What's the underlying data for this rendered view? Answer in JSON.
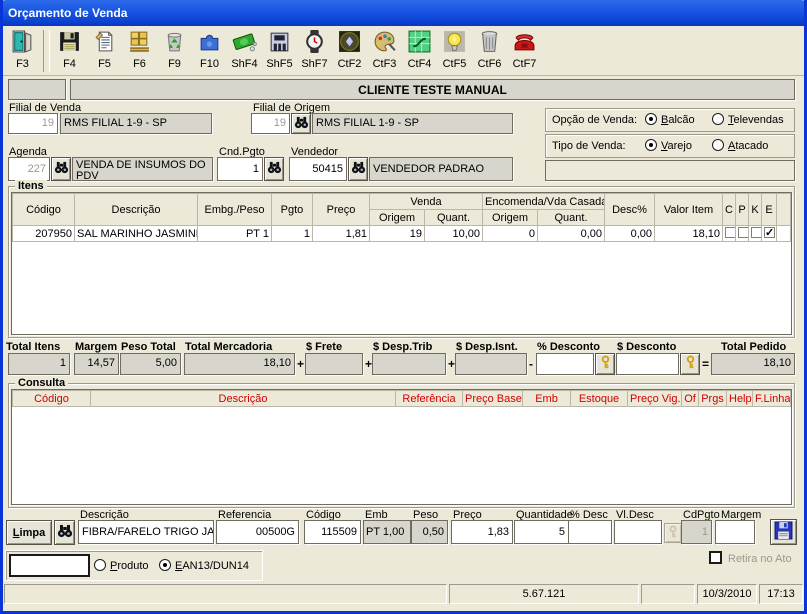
{
  "window": {
    "title": "Orçamento de Venda"
  },
  "colors": {
    "titlebar_blue": "#1755E2",
    "window_border": "#0834D8",
    "consulta_header_red": "#D40000",
    "background": "#ECE9D8"
  },
  "toolbar": {
    "buttons": [
      {
        "label": "F3",
        "icon": "exit-door-icon"
      },
      {
        "label": "F4",
        "icon": "save-floppy-icon"
      },
      {
        "label": "F5",
        "icon": "document-edit-icon"
      },
      {
        "label": "F6",
        "icon": "pallet-boxes-icon"
      },
      {
        "label": "F9",
        "icon": "recycle-bin-icon"
      },
      {
        "label": "F10",
        "icon": "puzzle-piece-icon"
      },
      {
        "label": "ShF4",
        "icon": "money-bill-icon"
      },
      {
        "label": "ShF5",
        "icon": "building-icon"
      },
      {
        "label": "ShF7",
        "icon": "watch-icon"
      },
      {
        "label": "CtF2",
        "icon": "emblem-icon"
      },
      {
        "label": "CtF3",
        "icon": "palette-icon"
      },
      {
        "label": "CtF4",
        "icon": "green-grid-icon"
      },
      {
        "label": "CtF5",
        "icon": "light-bulb-icon"
      },
      {
        "label": "CtF6",
        "icon": "trash-can-icon"
      },
      {
        "label": "CtF7",
        "icon": "red-phone-icon"
      }
    ]
  },
  "client": {
    "name": "CLIENTE TESTE MANUAL"
  },
  "filial_venda": {
    "label": "Filial de Venda",
    "code": "19",
    "name": "RMS FILIAL 1-9 - SP"
  },
  "filial_origem": {
    "label": "Filial de Origem",
    "code": "19",
    "name": "RMS FILIAL 1-9 - SP"
  },
  "opcao_venda": {
    "label": "Opção de Venda:",
    "balcao": "Balcão",
    "balcao_selected": true,
    "televendas": "Televendas",
    "televendas_selected": false
  },
  "tipo_venda": {
    "label": "Tipo de Venda:",
    "varejo": "Varejo",
    "varejo_selected": true,
    "atacado": "Atacado",
    "atacado_selected": false
  },
  "agenda": {
    "label": "Agenda",
    "code": "227",
    "name": "VENDA DE INSUMOS DO PDV"
  },
  "cnd_pgto": {
    "label": "Cnd.Pgto",
    "value": "1"
  },
  "vendedor": {
    "label": "Vendedor",
    "code": "50415",
    "name": "VENDEDOR PADRAO"
  },
  "itens": {
    "group_label": "Itens",
    "header": {
      "codigo": "Código",
      "descricao": "Descrição",
      "emb_peso": "Embg./Peso",
      "pgto": "Pgto",
      "preco": "Preço",
      "venda": "Venda",
      "venda_origem": "Origem",
      "venda_quant": "Quant.",
      "encomenda": "Encomenda/Vda Casada",
      "enc_origem": "Origem",
      "enc_quant": "Quant.",
      "desc_pct": "Desc%",
      "valor_item": "Valor Item",
      "c": "C",
      "p": "P",
      "k": "K",
      "e": "E"
    },
    "rows": [
      {
        "codigo": "207950",
        "descricao": "SAL MARINHO JASMINE",
        "emb_peso": "PT 1",
        "pgto": "1",
        "preco": "1,81",
        "venda_origem": "19",
        "venda_quant": "10,00",
        "enc_origem": "0",
        "enc_quant": "0,00",
        "desc_pct": "0,00",
        "valor_item": "18,10",
        "c": false,
        "p": false,
        "k": false,
        "e": true
      }
    ]
  },
  "totais": {
    "total_itens_label": "Total Itens",
    "total_itens": "1",
    "margem_label": "Margem",
    "margem": "14,57",
    "peso_total_label": "Peso Total",
    "peso_total": "5,00",
    "total_mercadoria_label": "Total Mercadoria",
    "total_mercadoria": "18,10",
    "frete_label": "$ Frete",
    "frete": "",
    "desp_trib_label": "$ Desp.Trib",
    "desp_trib": "",
    "desp_isnt_label": "$ Desp.Isnt.",
    "desp_isnt": "",
    "pct_desconto_label": "% Desconto",
    "pct_desconto": "",
    "desconto_label": "$ Desconto",
    "desconto": "",
    "total_pedido_label": "Total Pedido",
    "total_pedido": "18,10",
    "op_plus": "+",
    "op_minus": "-",
    "op_equals": "="
  },
  "consulta": {
    "group_label": "Consulta",
    "columns": [
      "Código",
      "Descrição",
      "Referência",
      "Preço Base",
      "Emb",
      "Estoque",
      "Preço Vig.",
      "Of",
      "Prgs",
      "Help",
      "F.Linha"
    ]
  },
  "entry": {
    "limpa": "Limpa",
    "descricao_label": "Descrição",
    "descricao": "FIBRA/FARELO TRIGO JA",
    "referencia_label": "Referencia",
    "referencia": "00500G",
    "codigo_label": "Código",
    "codigo": "115509",
    "emb_label": "Emb",
    "emb": "PT 1,00",
    "peso_label": "Peso",
    "peso": "0,50",
    "preco_label": "Preço",
    "preco": "1,83",
    "quantidade_label": "Quantidade",
    "quantidade": "5",
    "pct_desc_label": "% Desc",
    "pct_desc": "",
    "vl_desc_label": "Vl.Desc",
    "vl_desc": "",
    "cdpgto_label": "CdPgto",
    "cdpgto": "1",
    "margem_label": "Margem",
    "margem": ""
  },
  "footer": {
    "barcode_value": "",
    "produto": "Produto",
    "produto_selected": false,
    "ean": "EAN13/DUN14",
    "ean_selected": true,
    "retira": "Retira no Ato",
    "retira_checked": false
  },
  "statusbar": {
    "version": "5.67.121",
    "date": "10/3/2010",
    "time": "17:13"
  }
}
